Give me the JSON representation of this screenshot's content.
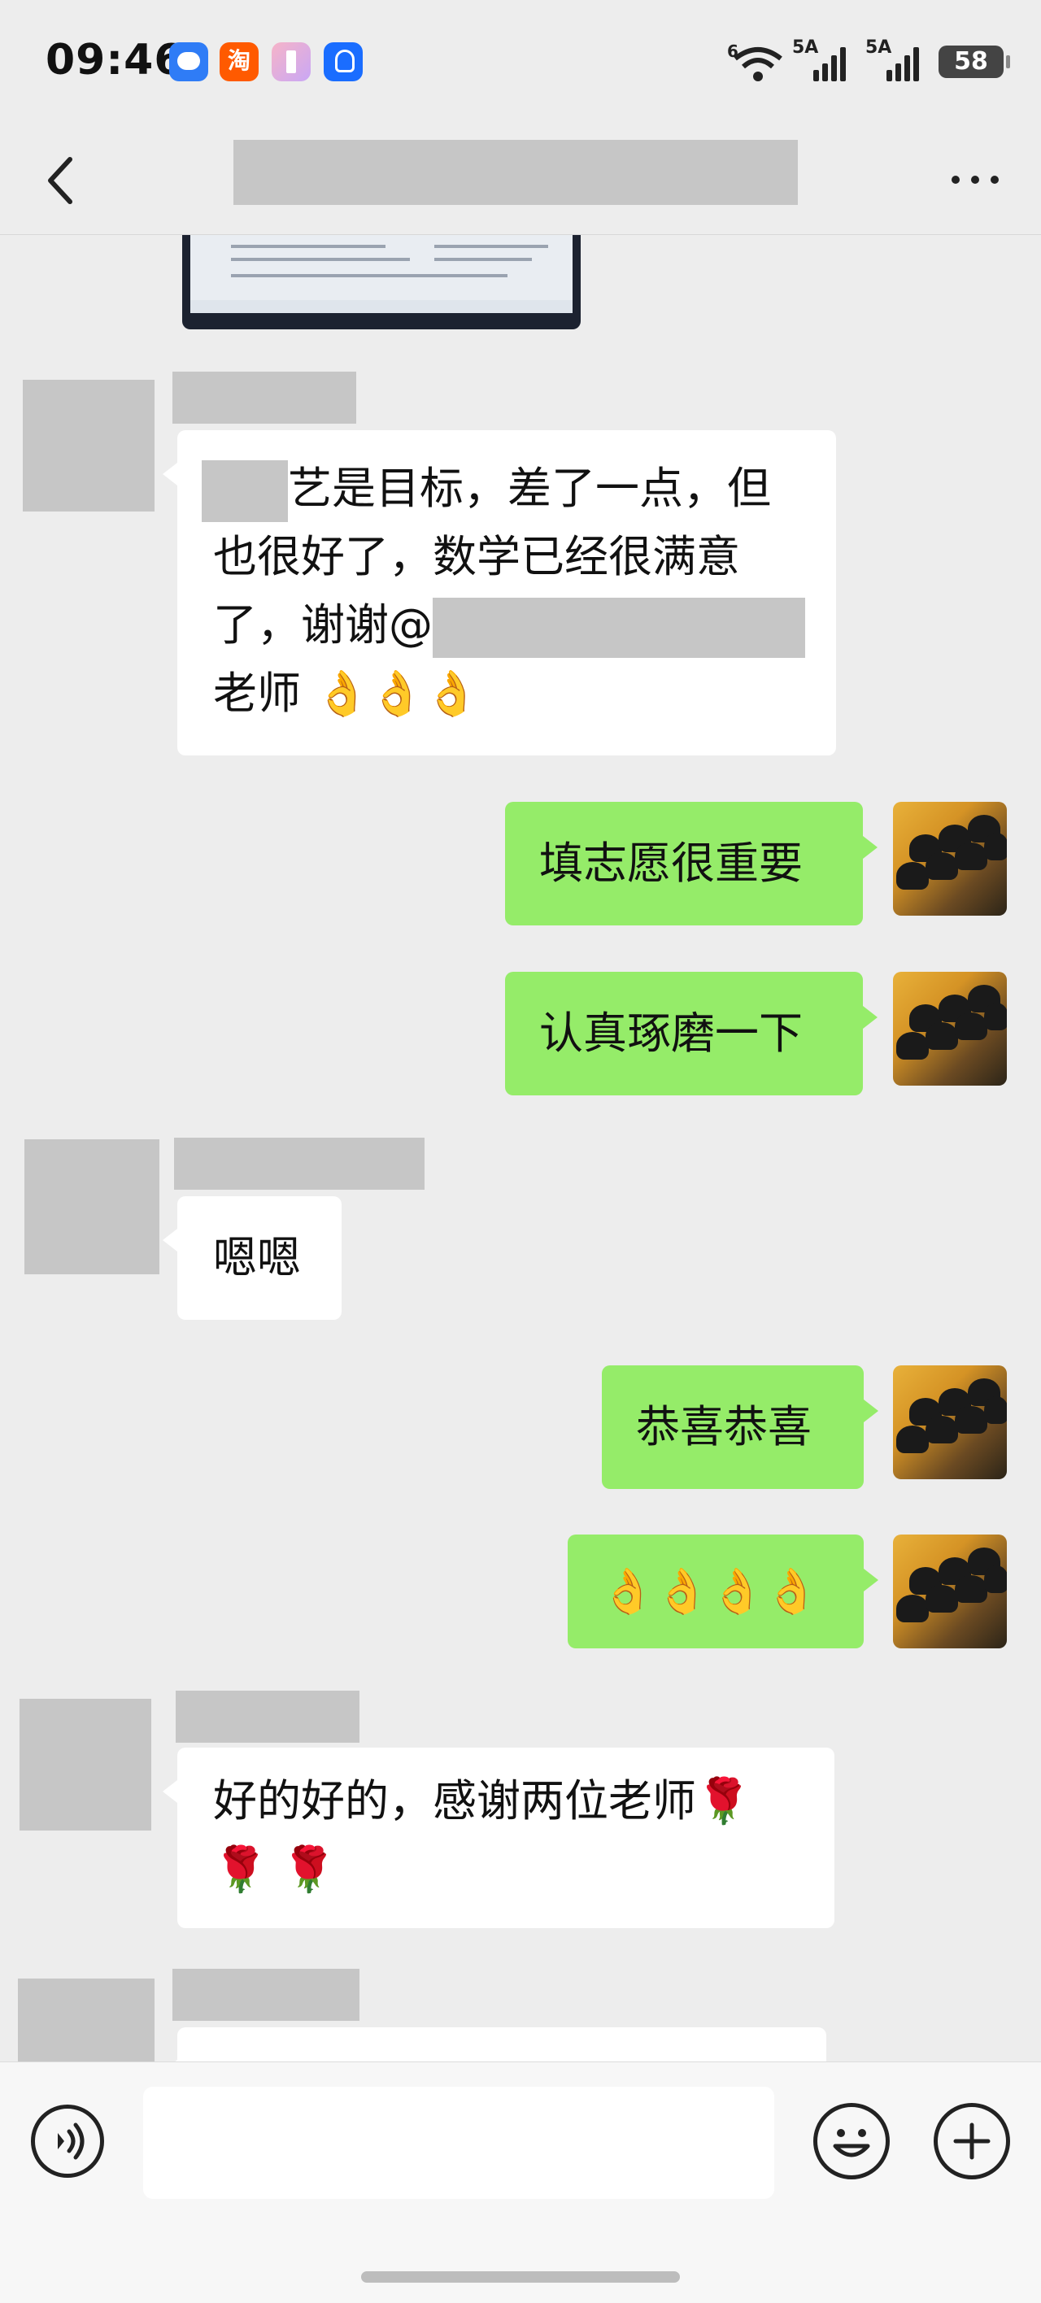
{
  "status_bar": {
    "time": "09:46",
    "app_icons": [
      "message-icon",
      "taobao-icon",
      "books-icon",
      "lightbulb-icon"
    ],
    "taobao_glyph": "淘",
    "wifi_label": "6",
    "signal1_label": "5A",
    "signal2_label": "5A",
    "battery": "58"
  },
  "nav": {
    "back_icon": "chevron-left-icon",
    "more_icon": "more-horizontal-icon"
  },
  "messages": [
    {
      "side": "in",
      "text_before": "",
      "text_after": "艺是目标，差了一点，但\n也很好了，数学已经很满意\n了，谢谢@",
      "text_end": "\n老师 👌👌👌"
    },
    {
      "side": "out",
      "text": "填志愿很重要"
    },
    {
      "side": "out",
      "text": "认真琢磨一下"
    },
    {
      "side": "in",
      "text": "嗯嗯"
    },
    {
      "side": "out",
      "text": "恭喜恭喜"
    },
    {
      "side": "out",
      "text": "👌👌👌👌"
    },
    {
      "side": "in",
      "text": "好的好的，感谢两位老师🌹\n🌹 🌹"
    }
  ],
  "input": {
    "placeholder": "",
    "value": ""
  },
  "colors": {
    "background": "#ededed",
    "outgoing_bubble": "#95ec69",
    "incoming_bubble": "#ffffff",
    "redaction": "#c6c6c6"
  }
}
